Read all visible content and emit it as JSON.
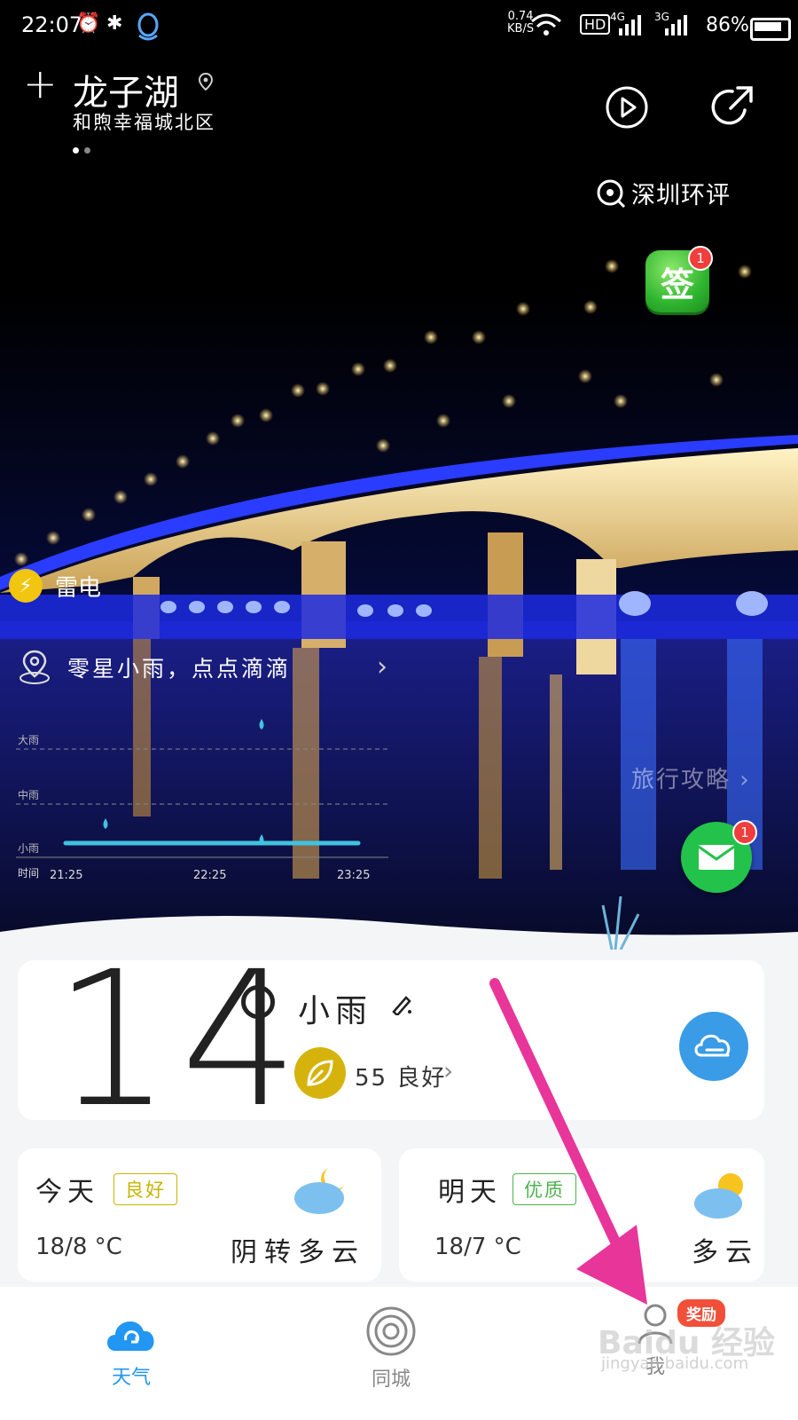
{
  "status_bar": {
    "time": "22:07",
    "speed_value": "0.74",
    "speed_unit": "KB/S",
    "hd": "HD",
    "net_1": "4G",
    "net_2": "3G",
    "battery": "86%"
  },
  "header": {
    "city": "龙子湖",
    "subtitle": "和煦幸福城北区",
    "env_label": "深圳环评"
  },
  "sign_button": {
    "label": "签",
    "badge": "1"
  },
  "alert": {
    "label": "雷电"
  },
  "rain_forecast": {
    "summary": "零星小雨，点点滴滴",
    "levels": [
      "大雨",
      "中雨",
      "小雨"
    ],
    "time_label": "时间",
    "times": [
      "21:25",
      "22:25",
      "23:25"
    ]
  },
  "travel_link": "旅行攻略",
  "mail_badge": "1",
  "current": {
    "temperature": "14",
    "condition": "小雨",
    "aqi": "55 良好"
  },
  "days": [
    {
      "name": "今天",
      "quality": "良好",
      "temp": "18/8 °C",
      "desc": "阴转多云"
    },
    {
      "name": "明天",
      "quality": "优质",
      "temp": "18/7 °C",
      "desc": "多云"
    }
  ],
  "tabs": [
    {
      "label": "天气"
    },
    {
      "label": "同城"
    },
    {
      "label": "我"
    }
  ],
  "reward_badge": "奖励",
  "watermark": {
    "brand": "Baidu 经验",
    "url": "jingyan.baidu.com"
  },
  "colors": {
    "accent": "#2196F3",
    "rain_line": "#3fc3e0",
    "alert_yellow": "#f2c510",
    "aqi_yellow": "#d6b30c",
    "good_badge": "#c9b400",
    "excellent_badge": "#4db24d",
    "annotation_arrow": "#e8359a"
  }
}
